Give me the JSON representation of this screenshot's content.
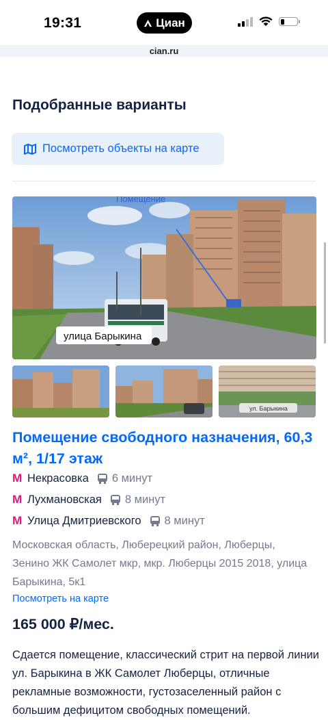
{
  "status_bar": {
    "time": "19:31",
    "app_pill": "Циан",
    "battery_level": 0.25
  },
  "browser": {
    "url": "cian.ru"
  },
  "section": {
    "title": "Подобранные варианты",
    "map_button": "Посмотреть объекты на карте"
  },
  "gallery": {
    "main_photo": {
      "annotation": "Помещение",
      "street_label": "улица Барыкина"
    },
    "thumbs": [
      {
        "street_label": ""
      },
      {
        "street_label": ""
      },
      {
        "street_label": "ул. Барыкина"
      }
    ]
  },
  "listing": {
    "title": "Помещение свободного назначения, 60,3 м², 1/17 этаж",
    "metro": [
      {
        "station": "Некрасовка",
        "time": "6 минут"
      },
      {
        "station": "Лухмановская",
        "time": "8 минут"
      },
      {
        "station": "Улица Дмитриевского",
        "time": "8 минут"
      }
    ],
    "address": "Московская область, Люберецкий район, Люберцы, Зенино ЖК Самолет мкр, мкр. Люберцы 2015 2018, улица Барыкина, 5к1",
    "map_link": "Посмотреть на карте",
    "price": "165 000 ₽/мес.",
    "description": "Сдается помещение, классический стрит на первой линии ул. Барыкина в ЖК Самолет Люберцы, отличные рекламные возможности, густозаселенный район с большим дефицитом свободных помещений."
  },
  "colors": {
    "accent": "#0468ff",
    "metro": "#e5197a",
    "text": "#152242",
    "muted": "#737a8e",
    "button_bg": "#e8f1fb"
  }
}
